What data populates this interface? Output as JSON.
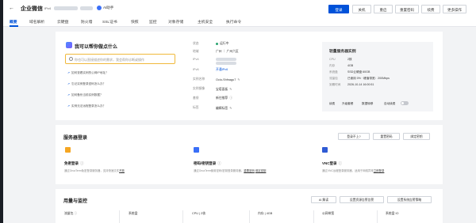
{
  "header": {
    "back_icon": "arrow-left-icon",
    "title": "企业微信",
    "tag": "IPv4",
    "ai_label": "AI助手",
    "buttons": {
      "login": "登录",
      "shutdown": "关机",
      "restart": "重启",
      "reset_password": "重置密码",
      "renew": "续费",
      "more": "更多操作"
    }
  },
  "tabs": [
    "概要",
    "域名解析",
    "云硬盘",
    "防火墙",
    "SSL证书",
    "快照",
    "监控",
    "对象存储",
    "主机安全",
    "执行命令"
  ],
  "active_tab": 0,
  "assistant": {
    "title": "我可以帮你做点什么",
    "placeholder": "你也可以直接描述你的需求，我会帮你诊断或操作",
    "questions": [
      "如何查看实例的公网IP地址？",
      "忘记实例登录密码怎么办？",
      "如何备份当前实例数据？",
      "实例无法远程登录怎么办？"
    ]
  },
  "info": {
    "status_label": "状态",
    "status_value": "运行中",
    "region_label": "地域",
    "region_value": "广州 ｜ 广州六区",
    "ipv4_label": "IPv4",
    "ipv6_label": "IPv6",
    "ipv6_value": "开通IPv6",
    "name_label": "实例名称",
    "name_value": "Ocio-Shfnagu7",
    "image_label": "实例镜像",
    "image_value": "宝塔面板",
    "package_label": "套餐",
    "package_value": "新住推荐",
    "tags_label": "标签",
    "tags_value": "编辑标签"
  },
  "spec": {
    "title": "轻量服务器实例",
    "cpu_label": "CPU",
    "cpu_value": "2核",
    "mem_label": "内存",
    "mem_value": "4GB",
    "disk_label": "系统盘",
    "disk_value": "SSD云硬盘 60GB",
    "traffic_label": "流量包",
    "traffic_value": "已使用 0% · 峰值带宽：200Mbps",
    "expire_label": "到期时间",
    "expire_value": "2026-10-14 16:00:51",
    "actions": [
      "续费",
      "升级套餐",
      "数据转移",
      "自动续费"
    ]
  },
  "login_section": {
    "title": "服务器登录",
    "help_button": "登录不上?",
    "reset_button": "重置密码",
    "bind_button": "绑定密钥",
    "methods": [
      {
        "icon": "terminal-icon",
        "color": "#f5a623",
        "title": "免密登录",
        "desc": "通过OrcaTerm免密登录服务器，支持快速文件",
        "desc_link": "开放"
      },
      {
        "icon": "key-icon",
        "color": "#3a6ff7",
        "title": "密码/密钥登录",
        "desc": "通过OrcaTerm使用密码/密钥登录服务器，",
        "desc_link": "重置密码",
        "desc_link2": "绑定密钥"
      },
      {
        "icon": "monitor-icon",
        "color": "#2f5bd4",
        "title": "VNC登录",
        "desc": "通过VNC远程登录服务器，适用于网络异常",
        "desc_link": "立即登录"
      }
    ]
  },
  "monitor_section": {
    "title": "用量与监控",
    "ai_button": "AI 解读",
    "alarm_button": "设置资源告警告警",
    "policy_button": "设置系统告警策略",
    "columns": [
      "流量包",
      "系统盘",
      "CPU | 2核",
      "内存 | 4GB",
      "公网带宽",
      "系统盘 IO"
    ]
  }
}
